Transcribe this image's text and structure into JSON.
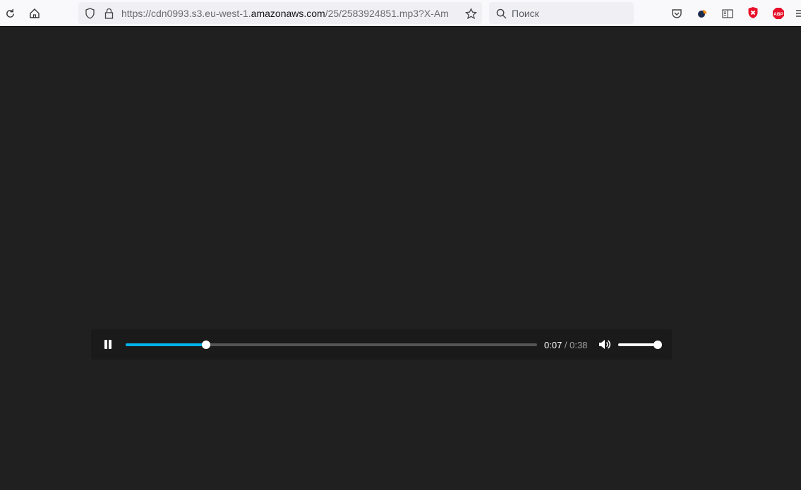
{
  "browser": {
    "url_prefix": "https://cdn0993.s3.eu-west-1.",
    "url_domain": "amazonaws.com",
    "url_suffix": "/25/2583924851.mp3?X-Am",
    "search_placeholder": "Поиск",
    "extensions": {
      "abp_label": "ABP"
    }
  },
  "player": {
    "state": "playing",
    "current_time": "0:07",
    "separator": " / ",
    "duration": "0:38",
    "progress_fraction": 0.196,
    "volume_fraction": 1.0,
    "colors": {
      "progress": "#00b3f0"
    }
  }
}
